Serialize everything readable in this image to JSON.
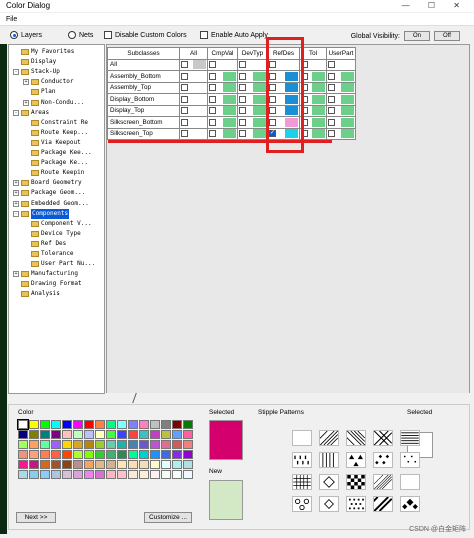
{
  "window": {
    "title": "Color Dialog",
    "controls": "— ☐ ✕"
  },
  "menu": {
    "file": "File"
  },
  "options": {
    "layers": "Layers",
    "nets": "Nets",
    "disable_custom": "Disable Custom Colors",
    "auto_apply": "Enable Auto Apply",
    "global_visibility": "Global Visibility:",
    "gv_on": "On",
    "gv_off": "Off"
  },
  "tree": [
    {
      "label": "My Favorites",
      "depth": 1,
      "box": ""
    },
    {
      "label": "Display",
      "depth": 1,
      "box": ""
    },
    {
      "label": "Stack-Up",
      "depth": 1,
      "box": "-"
    },
    {
      "label": "Conductor",
      "depth": 2,
      "box": "+"
    },
    {
      "label": "Plan",
      "depth": 2,
      "box": ""
    },
    {
      "label": "Non-Condu...",
      "depth": 2,
      "box": "+"
    },
    {
      "label": "Areas",
      "depth": 1,
      "box": "-"
    },
    {
      "label": "Constraint Re",
      "depth": 2,
      "box": ""
    },
    {
      "label": "Route Keep...",
      "depth": 2,
      "box": ""
    },
    {
      "label": "Via Keepout",
      "depth": 2,
      "box": ""
    },
    {
      "label": "Package Kee...",
      "depth": 2,
      "box": ""
    },
    {
      "label": "Package Ke...",
      "depth": 2,
      "box": ""
    },
    {
      "label": "Route Keepin",
      "depth": 2,
      "box": ""
    },
    {
      "label": "Board Geometry",
      "depth": 1,
      "box": "+"
    },
    {
      "label": "Package Geom...",
      "depth": 1,
      "box": "+"
    },
    {
      "label": "Embedded Geom...",
      "depth": 1,
      "box": "+"
    },
    {
      "label": "Components",
      "depth": 1,
      "box": "-",
      "selected": true
    },
    {
      "label": "Component V...",
      "depth": 2,
      "box": ""
    },
    {
      "label": "Device Type",
      "depth": 2,
      "box": ""
    },
    {
      "label": "Ref Des",
      "depth": 2,
      "box": ""
    },
    {
      "label": "Tolerance",
      "depth": 2,
      "box": ""
    },
    {
      "label": "User Part Nu...",
      "depth": 2,
      "box": ""
    },
    {
      "label": "Manufacturing",
      "depth": 1,
      "box": "+"
    },
    {
      "label": "Drawing Format",
      "depth": 1,
      "box": ""
    },
    {
      "label": "Analysis",
      "depth": 1,
      "box": ""
    }
  ],
  "grid": {
    "headers": [
      "Subclasses",
      "All",
      "CmpVal",
      "DevTyp",
      "RefDes",
      "Tol",
      "UserPart"
    ],
    "rows": [
      {
        "name": "All",
        "colors": [
          "#c8c8c8",
          "",
          "",
          "",
          "",
          ""
        ],
        "checks": [
          false,
          false,
          false,
          false,
          false,
          false
        ]
      },
      {
        "name": "Assembly_Bottom",
        "colors": [
          "",
          "#6ccf8a",
          "#6ccf8a",
          "#1a8fd6",
          "#6ccf8a",
          "#6ccf8a"
        ],
        "checks": [
          false,
          false,
          false,
          false,
          false,
          false
        ]
      },
      {
        "name": "Assembly_Top",
        "colors": [
          "",
          "#6ccf8a",
          "#6ccf8a",
          "#1a8fd6",
          "#6ccf8a",
          "#6ccf8a"
        ],
        "checks": [
          false,
          false,
          false,
          false,
          false,
          false
        ]
      },
      {
        "name": "Display_Bottom",
        "colors": [
          "",
          "#6ccf8a",
          "#6ccf8a",
          "#1a8fd6",
          "#6ccf8a",
          "#6ccf8a"
        ],
        "checks": [
          false,
          false,
          false,
          false,
          false,
          false
        ]
      },
      {
        "name": "Display_Top",
        "colors": [
          "",
          "#6ccf8a",
          "#6ccf8a",
          "#1a8fd6",
          "#6ccf8a",
          "#6ccf8a"
        ],
        "checks": [
          false,
          false,
          false,
          false,
          false,
          false
        ]
      },
      {
        "name": "Silkscreen_Bottom",
        "colors": [
          "",
          "#6ccf8a",
          "#6ccf8a",
          "#f29ad6",
          "#6ccf8a",
          "#6ccf8a"
        ],
        "checks": [
          false,
          false,
          false,
          false,
          false,
          false
        ]
      },
      {
        "name": "Silkscreen_Top",
        "colors": [
          "",
          "#6ccf8a",
          "#6ccf8a",
          "#1fd1e8",
          "#6ccf8a",
          "#6ccf8a"
        ],
        "checks": [
          false,
          false,
          false,
          true,
          false,
          false
        ]
      }
    ]
  },
  "color_panel": {
    "title": "Color",
    "next_button": "Next >>",
    "customize_button": "Customize ...",
    "palette": [
      "#ffffff",
      "#ffff00",
      "#00ff00",
      "#00ffff",
      "#0000ff",
      "#ff00ff",
      "#ff0000",
      "#ff8040",
      "#00ff80",
      "#80ffff",
      "#8080ff",
      "#ff80c0",
      "#c0c0c0",
      "#808080",
      "#800000",
      "#008000",
      "#000080",
      "#808000",
      "#008080",
      "#800080",
      "#ffc0c0",
      "#c0ffc0",
      "#c0c0ff",
      "#ffffc0",
      "#40ff40",
      "#4040ff",
      "#ff4040",
      "#40c0c0",
      "#c040c0",
      "#c0c040",
      "#60a0ff",
      "#ff60a0",
      "#a0ff60",
      "#ffa060",
      "#60ffa0",
      "#a060ff",
      "#ffd700",
      "#daa520",
      "#b8860b",
      "#9acd32",
      "#66cdaa",
      "#20b2aa",
      "#4682b4",
      "#6a5acd",
      "#ba55d3",
      "#db7093",
      "#cd5c5c",
      "#f08080",
      "#e9967a",
      "#ffa07a",
      "#ff7f50",
      "#ff6347",
      "#ff4500",
      "#adff2f",
      "#7fff00",
      "#32cd32",
      "#3cb371",
      "#2e8b57",
      "#00fa9a",
      "#00ced1",
      "#1e90ff",
      "#4169e1",
      "#8a2be2",
      "#9400d3",
      "#ff1493",
      "#c71585",
      "#d2691e",
      "#a0522d",
      "#8b4513",
      "#bc8f8f",
      "#f4a460",
      "#deb887",
      "#d2b48c",
      "#ffe4b5",
      "#ffdead",
      "#f5deb3",
      "#fffacd",
      "#e0ffff",
      "#afeeee",
      "#b0e0e6",
      "#add8e6",
      "#87ceeb",
      "#87cefa",
      "#b0c4de",
      "#d8bfd8",
      "#dda0dd",
      "#ee82ee",
      "#da70d6",
      "#ffb6c1",
      "#ffc0cb",
      "#faebd7",
      "#ffefd5",
      "#fff0f5",
      "#f0fff0",
      "#f5fffa",
      "#f0f8ff"
    ]
  },
  "selected_panel": {
    "title": "Selected",
    "color": "#d4006e",
    "new_title": "New",
    "new_color": "#d3e8c4"
  },
  "stipple_panel": {
    "title": "Stipple Patterns",
    "selected_title": "Selected"
  },
  "watermark": "CSDN @白金矩阵"
}
